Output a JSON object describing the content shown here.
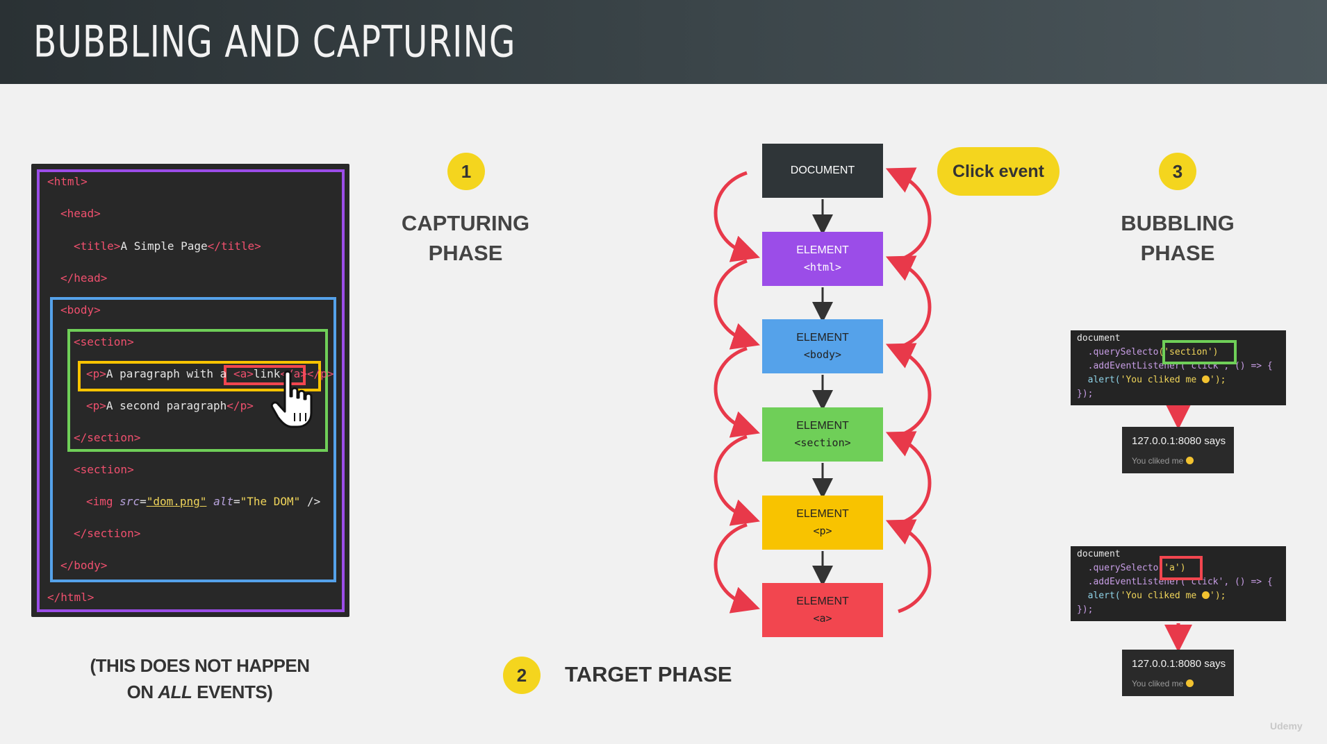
{
  "title": "BUBBLING AND CAPTURING",
  "code": {
    "lines": [
      {
        "parts": [
          [
            "tag",
            "<html>"
          ]
        ]
      },
      {
        "parts": [
          [
            "tag",
            "<head>"
          ]
        ]
      },
      {
        "parts": [
          [
            "tag",
            "<title>"
          ],
          [
            "txt",
            "A Simple Page"
          ],
          [
            "tag",
            "</title>"
          ]
        ]
      },
      {
        "parts": [
          [
            "tag",
            "</head>"
          ]
        ]
      },
      {
        "parts": [
          [
            "tag",
            "<body>"
          ]
        ]
      },
      {
        "parts": [
          [
            "tag",
            "<section>"
          ]
        ]
      },
      {
        "parts": [
          [
            "tag",
            "<p>"
          ],
          [
            "txt",
            "A paragraph with a "
          ],
          [
            "tag",
            "<a>"
          ],
          [
            "txt",
            "link"
          ],
          [
            "tag",
            "</a>"
          ],
          [
            "tag",
            "</p>"
          ]
        ]
      },
      {
        "parts": [
          [
            "tag",
            "<p>"
          ],
          [
            "txt",
            "A second paragraph"
          ],
          [
            "tag",
            "</p>"
          ]
        ]
      },
      {
        "parts": [
          [
            "tag",
            "</section>"
          ]
        ]
      },
      {
        "parts": [
          [
            "tag",
            "<section>"
          ]
        ]
      },
      {
        "parts": [
          [
            "tag",
            "<img "
          ],
          [
            "attr",
            "src"
          ],
          [
            "txt",
            "="
          ],
          [
            "str",
            "\"dom.png\""
          ],
          [
            "txt",
            " "
          ],
          [
            "attr",
            "alt"
          ],
          [
            "txt",
            "="
          ],
          [
            "str",
            "\"The DOM\""
          ],
          [
            "txt",
            " />"
          ]
        ]
      },
      {
        "parts": [
          [
            "tag",
            "</section>"
          ]
        ]
      },
      {
        "parts": [
          [
            "tag",
            "</body>"
          ]
        ]
      },
      {
        "parts": [
          [
            "tag",
            "</html>"
          ]
        ]
      }
    ]
  },
  "phases": {
    "capturing": {
      "number": "1",
      "line1": "CAPTURING",
      "line2": "PHASE"
    },
    "target": {
      "number": "2",
      "label": "TARGET PHASE"
    },
    "bubbling": {
      "number": "3",
      "line1": "BUBBLING",
      "line2": "PHASE"
    }
  },
  "click_event": "Click event",
  "nodes": [
    {
      "label": "DOCUMENT",
      "tag": "",
      "color": "#2f3538",
      "text_color": "#ffffff"
    },
    {
      "label": "ELEMENT",
      "tag": "<html>",
      "color": "#9b4de8",
      "text_color": "#ffffff"
    },
    {
      "label": "ELEMENT",
      "tag": "<body>",
      "color": "#55a2ea",
      "text_color": "#222222"
    },
    {
      "label": "ELEMENT",
      "tag": "<section>",
      "color": "#6fcf58",
      "text_color": "#222222"
    },
    {
      "label": "ELEMENT",
      "tag": "<p>",
      "color": "#f8c300",
      "text_color": "#222222"
    },
    {
      "label": "ELEMENT",
      "tag": "<a>",
      "color": "#f2464f",
      "text_color": "#222222"
    }
  ],
  "snippets": [
    {
      "line1": "document",
      "line2_pre": "  .querySelecto",
      "line2_sel": "('section')",
      "line3": "  .addEventListener('click', () => {",
      "line4_pre": "  alert(",
      "line4_str": "'You cliked me ",
      "line4_post": "');",
      "line5": "});"
    },
    {
      "line1": "document",
      "line2_pre": "  .querySelecto",
      "line2_sel": "('a')",
      "line3": "  .addEventListener('click', () => {",
      "line4_pre": "  alert(",
      "line4_str": "'You cliked me ",
      "line4_post": "');",
      "line5": "});"
    }
  ],
  "dialogs": [
    {
      "title": "127.0.0.1:8080 says",
      "message": "You cliked me"
    },
    {
      "title": "127.0.0.1:8080 says",
      "message": "You cliked me"
    }
  ],
  "note": {
    "line1": "(THIS DOES NOT HAPPEN",
    "line2_pre": "ON ",
    "line2_em": "ALL",
    "line2_post": " EVENTS)"
  },
  "watermark": "Udemy",
  "colors": {
    "purple": "#9b4de8",
    "blue": "#55a2ea",
    "green": "#6fcf58",
    "yellow": "#f8c300",
    "red": "#f2464f",
    "arrow_red": "#e8394a"
  }
}
